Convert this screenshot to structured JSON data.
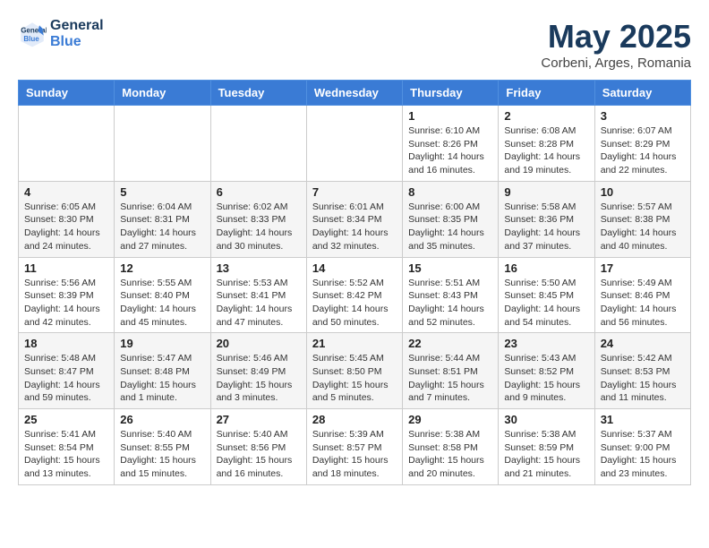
{
  "header": {
    "logo_line1": "General",
    "logo_line2": "Blue",
    "month": "May 2025",
    "location": "Corbeni, Arges, Romania"
  },
  "weekdays": [
    "Sunday",
    "Monday",
    "Tuesday",
    "Wednesday",
    "Thursday",
    "Friday",
    "Saturday"
  ],
  "weeks": [
    [
      {
        "day": "",
        "info": ""
      },
      {
        "day": "",
        "info": ""
      },
      {
        "day": "",
        "info": ""
      },
      {
        "day": "",
        "info": ""
      },
      {
        "day": "1",
        "info": "Sunrise: 6:10 AM\nSunset: 8:26 PM\nDaylight: 14 hours\nand 16 minutes."
      },
      {
        "day": "2",
        "info": "Sunrise: 6:08 AM\nSunset: 8:28 PM\nDaylight: 14 hours\nand 19 minutes."
      },
      {
        "day": "3",
        "info": "Sunrise: 6:07 AM\nSunset: 8:29 PM\nDaylight: 14 hours\nand 22 minutes."
      }
    ],
    [
      {
        "day": "4",
        "info": "Sunrise: 6:05 AM\nSunset: 8:30 PM\nDaylight: 14 hours\nand 24 minutes."
      },
      {
        "day": "5",
        "info": "Sunrise: 6:04 AM\nSunset: 8:31 PM\nDaylight: 14 hours\nand 27 minutes."
      },
      {
        "day": "6",
        "info": "Sunrise: 6:02 AM\nSunset: 8:33 PM\nDaylight: 14 hours\nand 30 minutes."
      },
      {
        "day": "7",
        "info": "Sunrise: 6:01 AM\nSunset: 8:34 PM\nDaylight: 14 hours\nand 32 minutes."
      },
      {
        "day": "8",
        "info": "Sunrise: 6:00 AM\nSunset: 8:35 PM\nDaylight: 14 hours\nand 35 minutes."
      },
      {
        "day": "9",
        "info": "Sunrise: 5:58 AM\nSunset: 8:36 PM\nDaylight: 14 hours\nand 37 minutes."
      },
      {
        "day": "10",
        "info": "Sunrise: 5:57 AM\nSunset: 8:38 PM\nDaylight: 14 hours\nand 40 minutes."
      }
    ],
    [
      {
        "day": "11",
        "info": "Sunrise: 5:56 AM\nSunset: 8:39 PM\nDaylight: 14 hours\nand 42 minutes."
      },
      {
        "day": "12",
        "info": "Sunrise: 5:55 AM\nSunset: 8:40 PM\nDaylight: 14 hours\nand 45 minutes."
      },
      {
        "day": "13",
        "info": "Sunrise: 5:53 AM\nSunset: 8:41 PM\nDaylight: 14 hours\nand 47 minutes."
      },
      {
        "day": "14",
        "info": "Sunrise: 5:52 AM\nSunset: 8:42 PM\nDaylight: 14 hours\nand 50 minutes."
      },
      {
        "day": "15",
        "info": "Sunrise: 5:51 AM\nSunset: 8:43 PM\nDaylight: 14 hours\nand 52 minutes."
      },
      {
        "day": "16",
        "info": "Sunrise: 5:50 AM\nSunset: 8:45 PM\nDaylight: 14 hours\nand 54 minutes."
      },
      {
        "day": "17",
        "info": "Sunrise: 5:49 AM\nSunset: 8:46 PM\nDaylight: 14 hours\nand 56 minutes."
      }
    ],
    [
      {
        "day": "18",
        "info": "Sunrise: 5:48 AM\nSunset: 8:47 PM\nDaylight: 14 hours\nand 59 minutes."
      },
      {
        "day": "19",
        "info": "Sunrise: 5:47 AM\nSunset: 8:48 PM\nDaylight: 15 hours\nand 1 minute."
      },
      {
        "day": "20",
        "info": "Sunrise: 5:46 AM\nSunset: 8:49 PM\nDaylight: 15 hours\nand 3 minutes."
      },
      {
        "day": "21",
        "info": "Sunrise: 5:45 AM\nSunset: 8:50 PM\nDaylight: 15 hours\nand 5 minutes."
      },
      {
        "day": "22",
        "info": "Sunrise: 5:44 AM\nSunset: 8:51 PM\nDaylight: 15 hours\nand 7 minutes."
      },
      {
        "day": "23",
        "info": "Sunrise: 5:43 AM\nSunset: 8:52 PM\nDaylight: 15 hours\nand 9 minutes."
      },
      {
        "day": "24",
        "info": "Sunrise: 5:42 AM\nSunset: 8:53 PM\nDaylight: 15 hours\nand 11 minutes."
      }
    ],
    [
      {
        "day": "25",
        "info": "Sunrise: 5:41 AM\nSunset: 8:54 PM\nDaylight: 15 hours\nand 13 minutes."
      },
      {
        "day": "26",
        "info": "Sunrise: 5:40 AM\nSunset: 8:55 PM\nDaylight: 15 hours\nand 15 minutes."
      },
      {
        "day": "27",
        "info": "Sunrise: 5:40 AM\nSunset: 8:56 PM\nDaylight: 15 hours\nand 16 minutes."
      },
      {
        "day": "28",
        "info": "Sunrise: 5:39 AM\nSunset: 8:57 PM\nDaylight: 15 hours\nand 18 minutes."
      },
      {
        "day": "29",
        "info": "Sunrise: 5:38 AM\nSunset: 8:58 PM\nDaylight: 15 hours\nand 20 minutes."
      },
      {
        "day": "30",
        "info": "Sunrise: 5:38 AM\nSunset: 8:59 PM\nDaylight: 15 hours\nand 21 minutes."
      },
      {
        "day": "31",
        "info": "Sunrise: 5:37 AM\nSunset: 9:00 PM\nDaylight: 15 hours\nand 23 minutes."
      }
    ]
  ]
}
